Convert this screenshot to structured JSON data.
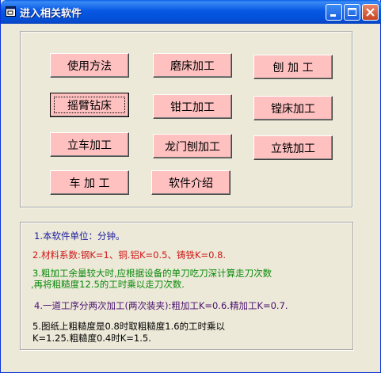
{
  "window": {
    "title": "进入相关软件"
  },
  "buttons": {
    "usage": "使用方法",
    "grinding": "磨床加工",
    "planing": "刨 加 工",
    "radial_drill": "摇臂钻床",
    "fitter": "钳工加工",
    "boring": "镗床加工",
    "vertical_lathe": "立车加工",
    "gantry_planer": "龙门刨加工",
    "vertical_milling": "立铣加工",
    "turning": "车 加 工",
    "intro": "软件介绍"
  },
  "notes": {
    "line1": "1.本软件单位：分钟。",
    "line2": "2.材料系数:钢K=1、铜.铝K=0.5、铸铁K=0.8.",
    "line3a": "3.粗加工余量较大时,应根据设备的单刀吃刀深计算走刀次数",
    "line3b": ",再将粗糙度12.5的工时乘以走刀次数.",
    "line4": "4.一道工序分两次加工(两次装夹):粗加工K=0.6.精加工K=0.7.",
    "line5a": "5.图纸上粗糙度是0.8时取粗糙度1.6的工时乘以",
    "line5b": "K=1.25.粗糙度0.4时K=1.5."
  },
  "colors": {
    "button_bg": "#ffc0c0",
    "note1": "#1a1aa0",
    "note2": "#d01818",
    "note3": "#0a8a0a",
    "note4": "#4a1070",
    "note5": "#000000"
  }
}
